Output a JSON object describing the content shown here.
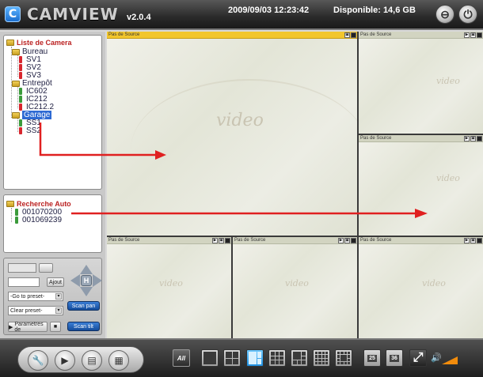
{
  "header": {
    "logo_text": "CAMVIEW",
    "version": "v2.0.4",
    "datetime": "2009/09/03 12:23:42",
    "disk_free": "Disponible: 14,6 GB"
  },
  "camera_list": {
    "title": "Liste de Camera",
    "groups": [
      {
        "name": "Bureau",
        "cameras": [
          "SV1",
          "SV2",
          "SV3"
        ]
      },
      {
        "name": "Entrepôt",
        "cameras": [
          "IC602",
          "IC212",
          "IC212.2"
        ]
      },
      {
        "name": "Garage",
        "cameras": [
          "SS1",
          "SS2"
        ]
      }
    ]
  },
  "auto_search": {
    "title": "Recherche Auto",
    "items": [
      "001070200",
      "001069239"
    ]
  },
  "ptz": {
    "add_label": "Ajout",
    "goto_preset": "-Go to preset-",
    "clear_preset": "Clear preset-",
    "scan_pan": "Scan pan",
    "scan_tilt": "Scan tilt",
    "settings_label": "Parametres de",
    "center_label": "H"
  },
  "video": {
    "no_source": "Pas de Source",
    "watermark": "video"
  },
  "toolbar": {
    "all_label": "All",
    "btn_25": "25",
    "btn_36": "36"
  },
  "colors": {
    "accent_blue": "#1f8fe0",
    "active_tile_header": "#f2c62d",
    "annotation_arrow": "#e02020",
    "tree_title_red": "#b22222"
  }
}
